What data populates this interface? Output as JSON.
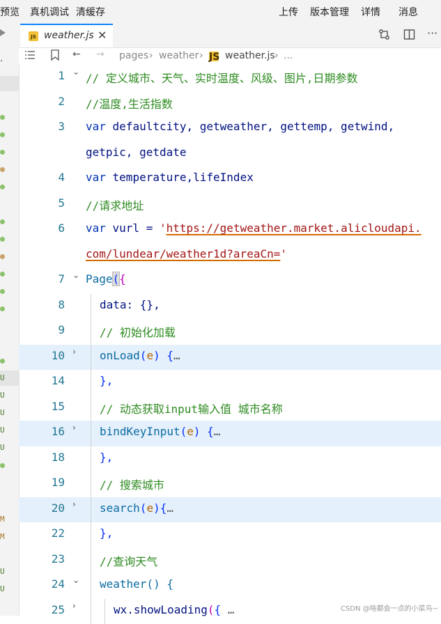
{
  "toolbar": {
    "items": [
      "预览",
      "真机调试",
      "清缓存",
      "上传",
      "版本管理",
      "详情",
      "消息"
    ]
  },
  "tab": {
    "filename": "weather.js",
    "badge": "JS",
    "close": "✕"
  },
  "breadcrumb": {
    "parts": [
      "pages",
      "weather",
      "weather.js",
      "..."
    ]
  },
  "editor": {
    "lines": [
      {
        "num": "1",
        "comment": "// 定义城市、天气、实时温度、风级、图片,日期参数"
      },
      {
        "num": "2",
        "comment": "//温度,生活指数"
      },
      {
        "num": "3",
        "kw": "var",
        "text": " defaultcity, getweather, gettemp, getwind,"
      },
      {
        "num": "",
        "text": "getpic, getdate"
      },
      {
        "num": "4",
        "kw": "var",
        "text": " temperature,lifeIndex"
      },
      {
        "num": "5",
        "comment": "//请求地址"
      },
      {
        "num": "6",
        "kw": "var",
        "text": " vurl = ",
        "str_q": "'",
        "url": "https://getweather.market.alicloudapi."
      },
      {
        "num": "",
        "url": "com/lundear/weather1d?areaCn=",
        "str_q": "'"
      },
      {
        "num": "7",
        "text": "Page"
      },
      {
        "num": "8",
        "text": "data: {},"
      },
      {
        "num": "9",
        "comment": "// 初始化加载"
      },
      {
        "num": "10",
        "text": "onLoad",
        "param": "e",
        "ellipsis": "…"
      },
      {
        "num": "14",
        "text": "},"
      },
      {
        "num": "15",
        "comment": "// 动态获取input输入值 城市名称"
      },
      {
        "num": "16",
        "text": "bindKeyInput",
        "param": "e",
        "ellipsis": "…"
      },
      {
        "num": "18",
        "text": "},"
      },
      {
        "num": "19",
        "comment": "// 搜索城市"
      },
      {
        "num": "20",
        "text": "search",
        "param": "e",
        "ellipsis": "…"
      },
      {
        "num": "22",
        "text": "},"
      },
      {
        "num": "23",
        "comment": "//查询天气"
      },
      {
        "num": "24",
        "text": "weather() {"
      },
      {
        "num": "25",
        "text": "wx.showLoading",
        "ellipsis": "…"
      }
    ]
  },
  "left_markers": [
    "U",
    "U",
    "U",
    "U",
    "U",
    "M",
    "M",
    "U",
    "U"
  ],
  "watermark": "CSDN @啥都会一点的小菜鸟~",
  "colors": {
    "accent": "#0a84ff",
    "comment": "#2e8b21",
    "keyword": "#0033b3",
    "string": "#a31515",
    "line_highlight": "#e4f0fb",
    "js_badge": "#f2c037"
  }
}
